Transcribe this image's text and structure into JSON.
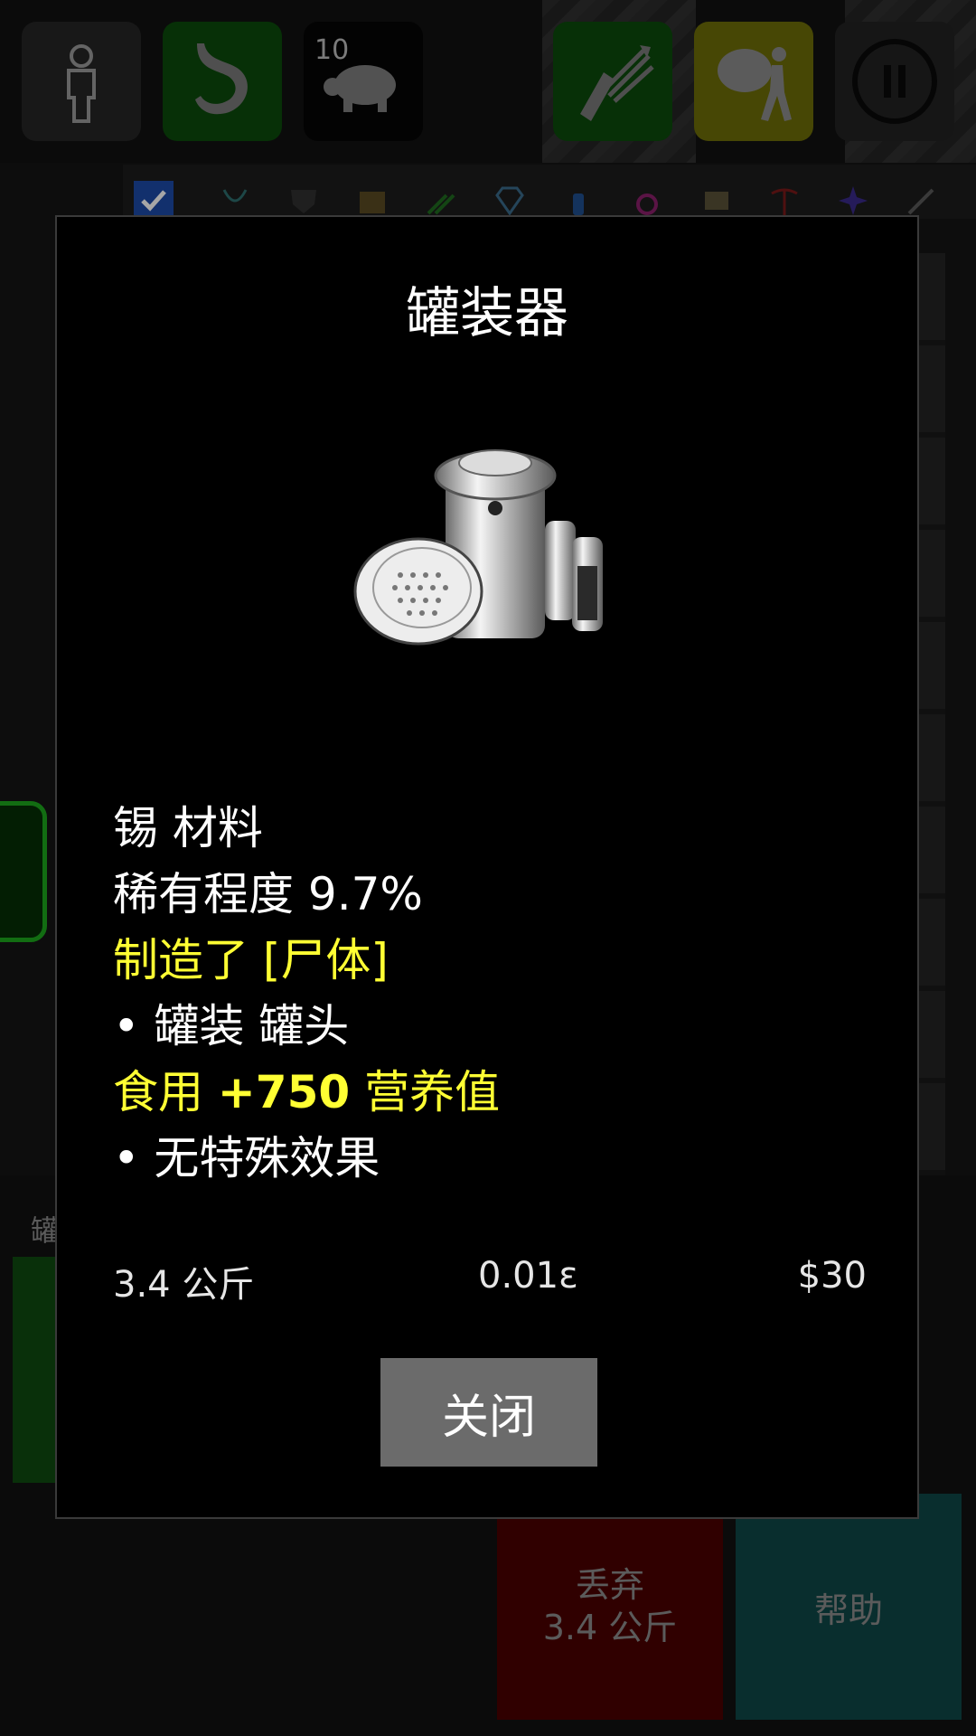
{
  "toolbar": {
    "turtle_count": "10"
  },
  "background": {
    "panel_label": "罐",
    "drop_button": {
      "line1": "丢弃",
      "line2": "3.4 公斤"
    },
    "help_button": "帮助"
  },
  "dialog": {
    "title": "罐装器",
    "lines": [
      {
        "text": "锡 材料",
        "color": "white"
      },
      {
        "text": "稀有程度 9.7%",
        "color": "white"
      },
      {
        "text": "制造了 [尸体]",
        "color": "yellow"
      },
      {
        "text": "• 罐装 罐头",
        "color": "white"
      },
      {
        "text_prefix": "食用 ",
        "text_bold": "+750",
        "text_suffix": " 营养值",
        "color": "yellow"
      },
      {
        "text": "• 无特殊效果",
        "color": "white"
      }
    ],
    "weight": "3.4 公斤",
    "volume": "0.01ε",
    "price": "$30",
    "close_label": "关闭"
  },
  "colors": {
    "highlight": "#ffff33",
    "text": "#ffffff",
    "close_button": "#6b6b6b",
    "drop_button": "#4a0000",
    "help_button": "#0e4848"
  },
  "icons": [
    "person-icon",
    "stomach-icon",
    "turtle-icon",
    "arrows-icon",
    "backpack-carrier-icon",
    "pause-icon"
  ]
}
